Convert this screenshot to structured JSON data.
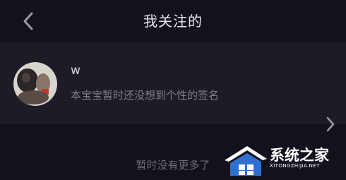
{
  "header": {
    "title": "我关注的",
    "back_icon": "chevron-left-icon"
  },
  "following": [
    {
      "username": "w",
      "signature": "本宝宝暂时还没想到个性的签名",
      "chevron_icon": "chevron-right-icon"
    }
  ],
  "empty_state": {
    "text": "暂时没有更多了"
  },
  "watermark": {
    "title": "系统之家",
    "subtitle": "XITONGZHIJIA.NET"
  },
  "colors": {
    "background": "#13121c",
    "row_background": "#1c1b26",
    "primary_text": "#e6e6ea",
    "secondary_text": "#80808a",
    "icon": "#9a9aa4",
    "watermark_blue": "#2f6fd1"
  }
}
